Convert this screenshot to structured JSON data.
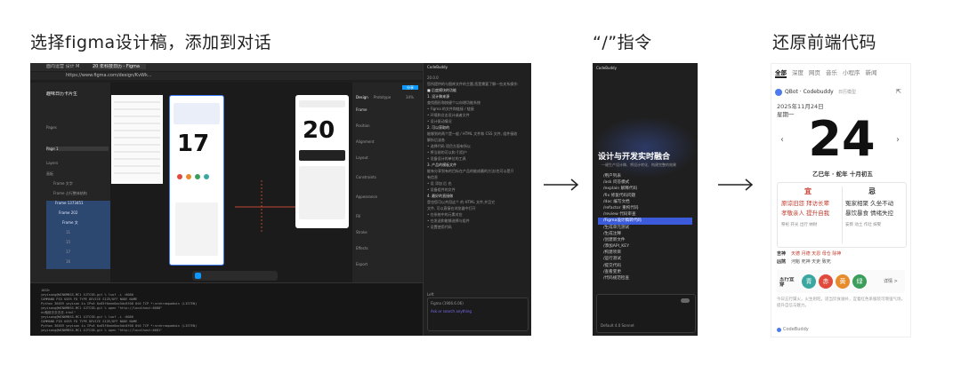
{
  "headings": {
    "step1": "选择figma设计稿，添加到对话",
    "step2": "“/”指令",
    "step3": "还原前端代码"
  },
  "figma": {
    "tabs": [
      "面向运营 设计 M",
      "20 年科技日历 - Figma"
    ],
    "url": "https://www.figma.com/design/KvWk...",
    "file_name": "趣味日历卡片生",
    "pages_label": "Pages",
    "page1": "Page 1",
    "layers_label": "Layers",
    "layers": [
      "画板",
      "Frame 文字",
      "Frame 占行整体结构",
      "Frame 1373451",
      "Frame 202",
      "Frame 文",
      "11",
      "15",
      "17",
      "16"
    ],
    "share_label": "分享",
    "design_tab": "Design",
    "prototype_tab": "Prototype",
    "zoom": "34%",
    "props": [
      "Frame",
      "Position",
      "Alignment",
      "Layout",
      "Constraints",
      "Appearance",
      "Fill",
      "Stroke",
      "Effects",
      "Export"
    ],
    "calendar_left_number": "17",
    "calendar_right_number": "20",
    "terminal_lines": [
      "1020:",
      "yeyisang@WIN6MBSS-MC1 XJTCSB-git % lsof -i :8080",
      "COMMAND    PID  USER   FD  TYPE             DEVICE SIZE/OFF NODE NAME",
      "Python   36859 yeyisan  4u  IPv6 0x65f6eee6ac5dc8f08   0t0  TCP *:nrnhrnmpadmin (LISTEN)",
      "yeyisang@WIN6MBSS-MC1 XJTCSB-git % open \"http://localhost:8080\"",
      "ec敲前去去去去.html\"",
      "yeyisang@WIN6MBSS-MC1 XJTCSB-git % lsof -i :8080",
      "COMMAND    PID  USER   FD  TYPE             DEVICE SIZE/OFF NODE NAME",
      "Python   36859 yeyisan  4u  IPv6 0x65f6eee6ac5dc8f08   0t0  TCP *:nrnhrnmpadmin (LISTEN)",
      "yeyisang@WIN6MBSS-MC1 XJTCSB-git % open \"http://localhost:8081\""
    ],
    "chat_header": "CodeBuddy",
    "chat_lines": [
      "20.0.0",
      "您所提供的与图库文件的主题,您是需要了解一些关系操作:",
      "■ 后度模块的功能",
      "1. 设计稿来源",
      "查找图形和按键个以向增功能系统",
      "• Figma 的文件和链接 / 链接",
      "• 环境和点击设计或者文件",
      "• 设计驱动情况",
      "2. 可以获取的",
      "能够到的两个是一般 / HTML 文件和 CSS 文件, 组件接收",
      "解析后该各",
      "• 选择代码 项目方面有所以",
      "• 将当前的可以和 引用户",
      "• 设备设计的单位的工具",
      "3. 产品的模板文件",
      "能有分享到有的目标在产品的能成最的方法(也可以是只",
      "有信息",
      "• 设 添加 后 也",
      "• 设备组件的文件",
      "4. 最好的直接做",
      "是也您可以共用这个 的 HTML 文件,并且它",
      "文件, 可以直接在浏览器中打开",
      "• 在系统中的元素对应",
      "• 在发送和能够选择与组件",
      "• 设置使用代码"
    ],
    "files": [
      "Left",
      "Copy",
      "Draft"
    ],
    "chat_input_chip": "Figma (1906.6.06)",
    "chat_input_placeholder": "Ask or search anything"
  },
  "panel2": {
    "header": "CodeBuddy",
    "banner_title": "设计与开发实时融合",
    "banner_subtitle": "一键生产设计稿、将设计转化、构建完整的效果",
    "commands": [
      "/用户列表",
      "/ask 问答模式",
      "/explain 解释代码",
      "/fix 修复代码问题",
      "/doc 编写文档",
      "/refactor 重构代码",
      "/review 代码审查",
      "/Figma设计稿转代码",
      "/生成单元测试",
      "/生成注释",
      "/创建新文件",
      "/添加API_KEY",
      "/构建项目",
      "/运行测试",
      "/提交代码",
      "/查看变更",
      "/代码规范检查"
    ],
    "highlight_index": 7,
    "input_chip": "Default 4.0 Sonnet"
  },
  "calendar": {
    "tabs": [
      "全部",
      "深度",
      "网页",
      "音乐",
      "小程序",
      "新闻"
    ],
    "source": "QBot · Codebuddy",
    "source_sub": "日历模型",
    "date_line": "2025年11月24日",
    "weekday": "星期一",
    "big_number": "24",
    "lunar": "乙巳年 · 蛇年  十月初五",
    "yi_label": "宜",
    "ji_label": "忌",
    "yi_items": [
      "原谅旧怨",
      "拜访长辈",
      "孝敬亲人",
      "提升自我"
    ],
    "ji_items": [
      "冤家相聚",
      "久坐不动",
      "暴饮暴食",
      "情绪失控"
    ],
    "yi_detail": "祭祀 开光 出行 纳财",
    "ji_detail": "安葬 动土 作灶 嫁娶",
    "good_label": "吉神",
    "good_items": "天德 月德 天恩 母仓 除神",
    "bad_label": "凶煞",
    "bad_items": "河魁 死神 天吏 致死",
    "wuxing_label": "五行宜穿",
    "wuxing_dots": [
      {
        "char": "青",
        "color": "#3aa7a0"
      },
      {
        "char": "赤",
        "color": "#e04a3c"
      },
      {
        "char": "黄",
        "color": "#e88b2a"
      },
      {
        "char": "绿",
        "color": "#3b9e5b"
      }
    ],
    "more_label": "详情 >",
    "tip": "今日五行属火，火生则旺，适当饮食滋补，宜着红色系服装可增强气场，提升自信与魅力。",
    "footer": "CodeBuddy"
  },
  "colors": {
    "figma_bg": "#1e1e1e",
    "figma_accent": "#0d99ff",
    "highlight": "#3b5bdb",
    "good_red": "#c0392b"
  }
}
